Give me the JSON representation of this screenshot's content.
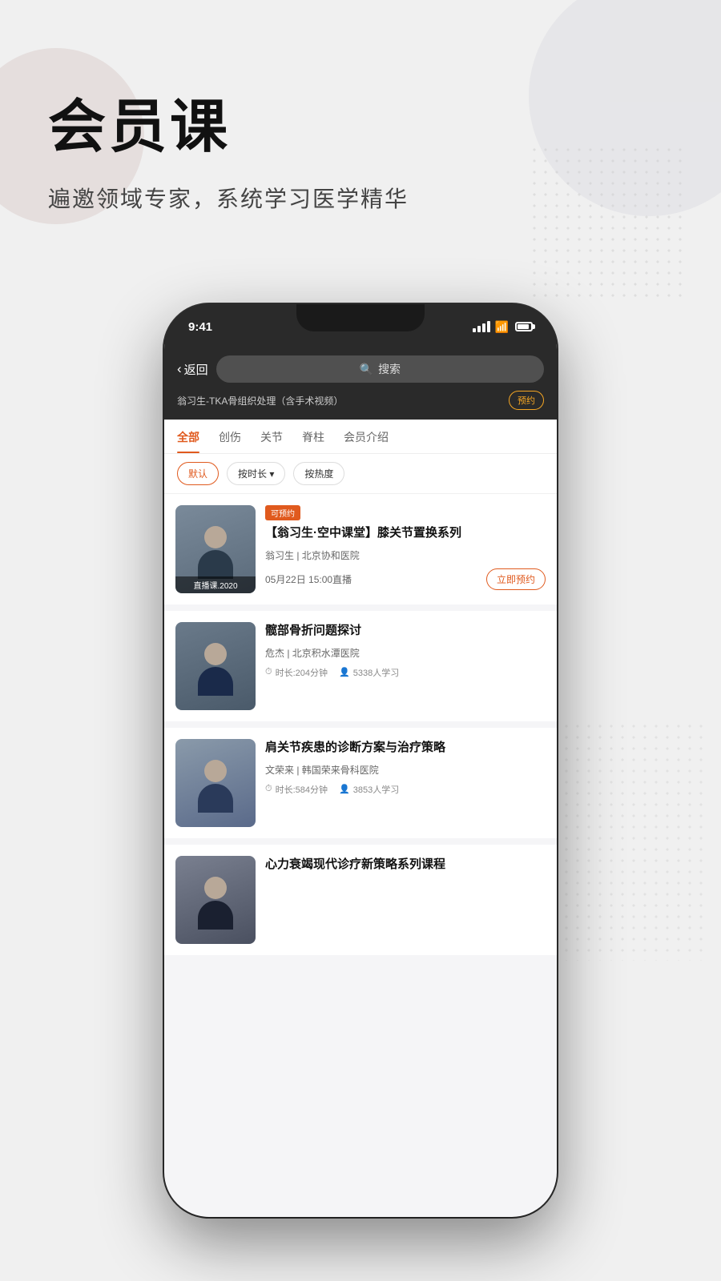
{
  "hero": {
    "title": "会员课",
    "subtitle": "遍邀领域专家，系统学习医学精华"
  },
  "phone": {
    "status_bar": {
      "time": "9:41"
    },
    "nav": {
      "back_label": "返回",
      "search_placeholder": "搜索"
    },
    "announce": {
      "text": "翁习生-TKA骨组织处理（含手术视频）",
      "btn_label": "预约"
    },
    "tabs": [
      {
        "label": "全部",
        "active": true
      },
      {
        "label": "创伤",
        "active": false
      },
      {
        "label": "关节",
        "active": false
      },
      {
        "label": "脊柱",
        "active": false
      },
      {
        "label": "会员介绍",
        "active": false
      }
    ],
    "filters": [
      {
        "label": "默认",
        "active": true
      },
      {
        "label": "按时长 ▾",
        "active": false
      },
      {
        "label": "按热度",
        "active": false
      }
    ],
    "courses": [
      {
        "tag": "可预约",
        "title": "【翁习生·空中课堂】膝关节置换系列",
        "author": "翁习生 | 北京协和医院",
        "date": "05月22日 15:00直播",
        "action_btn": "立即预约",
        "thumb_label": "直播课.2020"
      },
      {
        "tag": "",
        "title": "髋部骨折问题探讨",
        "author": "危杰 | 北京积水潭医院",
        "duration": "时长:204分钟",
        "learners": "5338人学习",
        "action_btn": ""
      },
      {
        "tag": "",
        "title": "肩关节疾患的诊断方案与治疗策略",
        "author": "文荣来 | 韩国荣来骨科医院",
        "duration": "时长:584分钟",
        "learners": "3853人学习",
        "action_btn": ""
      },
      {
        "tag": "",
        "title": "心力衰竭现代诊疗新策略系列课程",
        "author": "",
        "duration": "",
        "learners": "",
        "action_btn": ""
      }
    ]
  }
}
